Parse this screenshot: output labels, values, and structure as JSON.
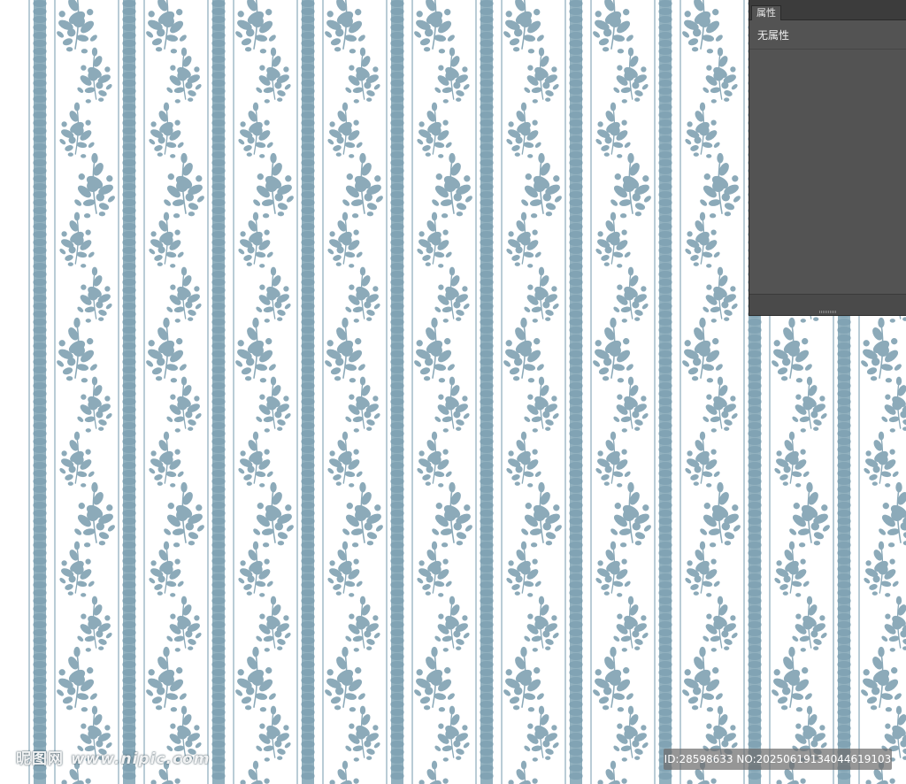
{
  "colors": {
    "pattern_blue": "#7fa3b4",
    "pattern_blue_dark": "#6d93a6",
    "panel_bg": "#535353",
    "panel_tabbar": "#3c3c3c"
  },
  "panel": {
    "tab_label": "属性",
    "body_text": "无属性"
  },
  "watermark": {
    "brand": "昵图网",
    "url": "www.nipic.com",
    "id_text": "ID:28598633 NO:20250619134044619103"
  },
  "canvas": {
    "pattern": "blue floral stripe wallpaper"
  }
}
